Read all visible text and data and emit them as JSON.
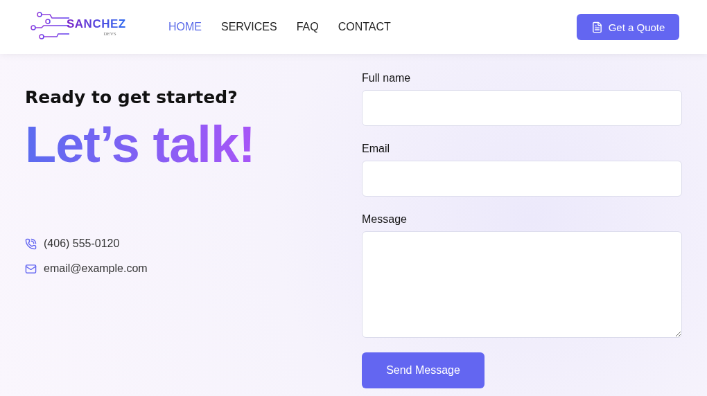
{
  "logo": {
    "name": "SANCHEZ",
    "tagline": "DEVS"
  },
  "nav": [
    {
      "label": "HOME",
      "selected": true
    },
    {
      "label": "SERVICES",
      "selected": false
    },
    {
      "label": "FAQ",
      "selected": false
    },
    {
      "label": "CONTACT",
      "selected": false
    }
  ],
  "quote_button": "Get a Quote",
  "hero": {
    "subtitle": "Ready to get started?",
    "title": "Let’s talk!"
  },
  "contacts": [
    {
      "kind": "phone",
      "text": "(406) 555-0120"
    },
    {
      "kind": "email",
      "text": "email@example.com"
    }
  ],
  "form": {
    "fields": [
      {
        "kind": "input",
        "label": "Full name"
      },
      {
        "kind": "input",
        "label": "Email"
      },
      {
        "kind": "textarea",
        "label": "Message"
      }
    ],
    "submit": "Send Message"
  }
}
